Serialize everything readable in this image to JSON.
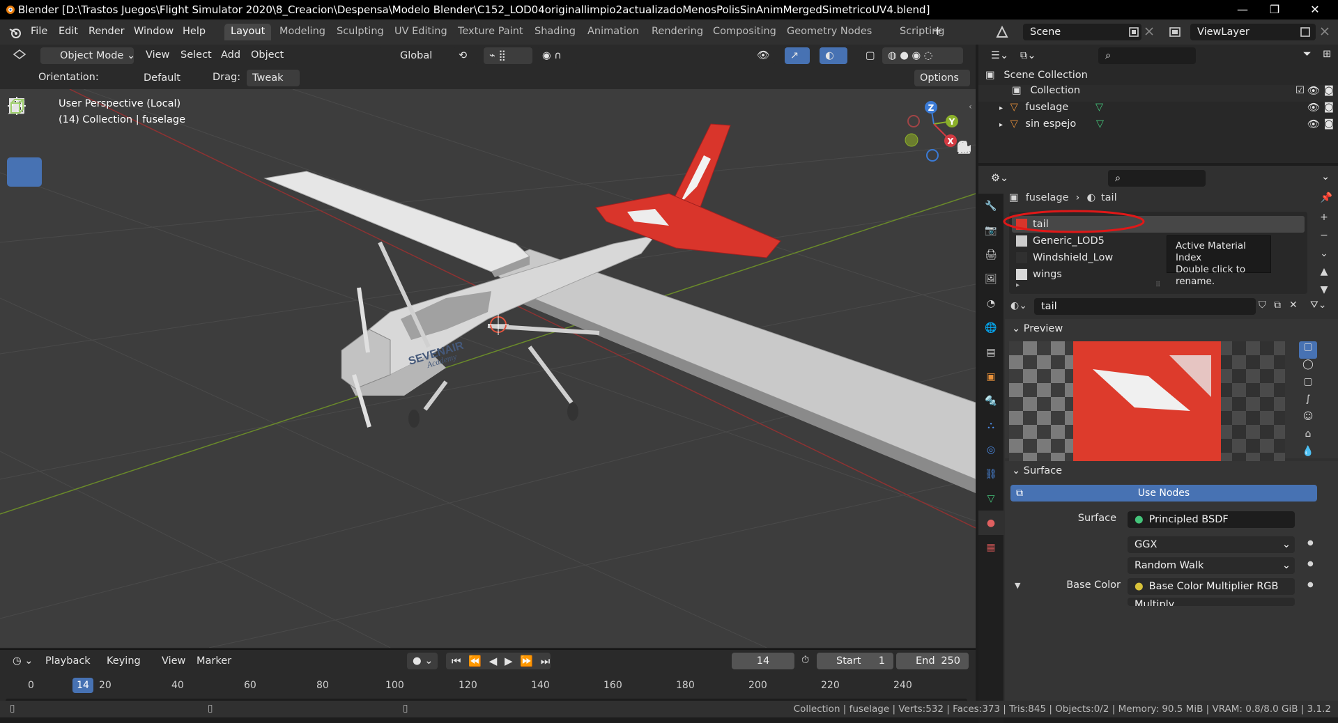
{
  "window": {
    "title": "Blender [D:\\Trastos Juegos\\Flight Simulator 2020\\8_Creacion\\Despensa\\Modelo Blender\\C152_LOD04originallimpio2actualizadoMenosPolisSinAnimMergedSimetricoUV4.blend]",
    "min": "—",
    "max": "❐",
    "close": "✕"
  },
  "menu": {
    "items": [
      "File",
      "Edit",
      "Render",
      "Window",
      "Help"
    ],
    "workspaces": [
      "Layout",
      "Modeling",
      "Sculpting",
      "UV Editing",
      "Texture Paint",
      "Shading",
      "Animation",
      "Rendering",
      "Compositing",
      "Geometry Nodes",
      "Scripting"
    ],
    "add": "+",
    "scene": "Scene",
    "view_layer": "ViewLayer"
  },
  "header": {
    "mode": "Object Mode",
    "view": "View",
    "select": "Select",
    "add": "Add",
    "object": "Object",
    "transform": "Global"
  },
  "tool_options": {
    "orientation_label": "Orientation:",
    "orientation": "Default",
    "drag_label": "Drag:",
    "drag": "Tweak",
    "options": "Options"
  },
  "viewport": {
    "perspective": "User Perspective (Local)",
    "collection": "(14) Collection | fuselage",
    "aircraft_text": "SEVENAIR",
    "aircraft_sub": "Academy"
  },
  "gizmo": {
    "z": "Z",
    "y": "Y",
    "x": "X"
  },
  "outliner": {
    "scene_collection": "Scene Collection",
    "collection": "Collection",
    "objects": [
      "fuselage",
      "sin espejo"
    ]
  },
  "properties": {
    "breadcrumb_object": "fuselage",
    "breadcrumb_material": "tail",
    "materials": [
      "tail",
      "Generic_LOD5",
      "Windshield_Low",
      "wings"
    ],
    "tooltip_line1": "Active Material Index",
    "tooltip_line2": "Double click to rename.",
    "material_name": "tail",
    "preview_label": "Preview",
    "surface_label": "Surface",
    "use_nodes": "Use Nodes",
    "surface_field_label": "Surface",
    "surface_shader": "Principled BSDF",
    "distribution": "GGX",
    "subsurface": "Random Walk",
    "base_color_label": "Base Color",
    "base_color": "Base Color Multiplier RGB",
    "next_node": "Multiply"
  },
  "timeline": {
    "playback": "Playback",
    "keying": "Keying",
    "view": "View",
    "marker": "Marker",
    "current_frame": "14",
    "start_label": "Start",
    "start": "1",
    "end_label": "End",
    "end": "250",
    "ticks": [
      "0",
      "20",
      "40",
      "60",
      "80",
      "100",
      "120",
      "140",
      "160",
      "180",
      "200",
      "220",
      "240"
    ],
    "cursor": "14"
  },
  "status": {
    "text": "Collection | fuselage | Verts:532 | Faces:373 | Tris:845 | Objects:0/2 | Memory: 90.5 MiB | VRAM: 0.8/8.0 GiB | 3.1.2"
  },
  "colors": {
    "accent": "#4772b3",
    "tail_red": "#d9352b",
    "highlight_circle": "#e01818"
  }
}
